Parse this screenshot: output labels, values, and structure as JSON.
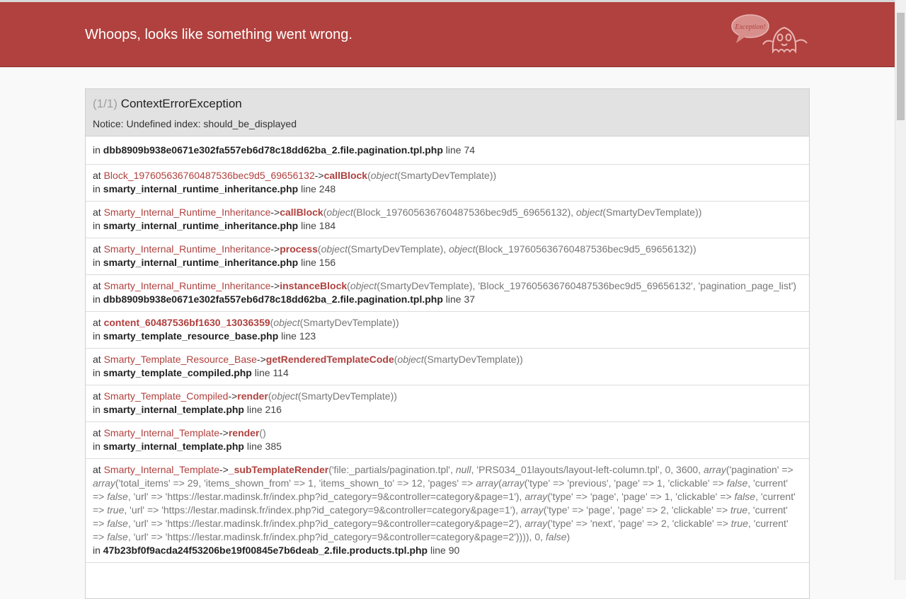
{
  "header": {
    "title": "Whoops, looks like something went wrong.",
    "logo_text": "Exception!"
  },
  "exception": {
    "count": "(1/1)",
    "class": "ContextErrorException",
    "message": "Notice: Undefined index: should_be_displayed"
  },
  "labels": {
    "in": "in",
    "at": "at",
    "line": "line",
    "arrow": "->"
  },
  "origin": {
    "file": "dbb8909b938e0671e302fa557eb6d78c18dd62ba_2.file.pagination.tpl.php",
    "line": "74"
  },
  "trace": [
    {
      "class": "Block_197605636760487536bec9d5_69656132",
      "func": "callBlock",
      "args_a": "(",
      "ph1": "object",
      "args_b": "(SmartyDevTemplate))",
      "ph2": "",
      "args_c": "",
      "file": "smarty_internal_runtime_inheritance.php",
      "line": "248"
    },
    {
      "class": "Smarty_Internal_Runtime_Inheritance",
      "func": "callBlock",
      "args_a": "(",
      "ph1": "object",
      "args_b": "(Block_197605636760487536bec9d5_69656132), ",
      "ph2": "object",
      "args_c": "(SmartyDevTemplate))",
      "file": "smarty_internal_runtime_inheritance.php",
      "line": "184"
    },
    {
      "class": "Smarty_Internal_Runtime_Inheritance",
      "func": "process",
      "args_a": "(",
      "ph1": "object",
      "args_b": "(SmartyDevTemplate), ",
      "ph2": "object",
      "args_c": "(Block_197605636760487536bec9d5_69656132))",
      "file": "smarty_internal_runtime_inheritance.php",
      "line": "156"
    },
    {
      "class": "Smarty_Internal_Runtime_Inheritance",
      "func": "instanceBlock",
      "args_a": "(",
      "ph1": "object",
      "args_b": "(SmartyDevTemplate), 'Block_197605636760487536bec9d5_69656132', 'pagination_page_list')",
      "ph2": "",
      "args_c": "",
      "file": "dbb8909b938e0671e302fa557eb6d78c18dd62ba_2.file.pagination.tpl.php",
      "line": "37"
    },
    {
      "class": "",
      "func": "content_60487536bf1630_13036359",
      "args_a": "(",
      "ph1": "object",
      "args_b": "(SmartyDevTemplate))",
      "ph2": "",
      "args_c": "",
      "file": "smarty_template_resource_base.php",
      "line": "123"
    },
    {
      "class": "Smarty_Template_Resource_Base",
      "func": "getRenderedTemplateCode",
      "args_a": "(",
      "ph1": "object",
      "args_b": "(SmartyDevTemplate))",
      "ph2": "",
      "args_c": "",
      "file": "smarty_template_compiled.php",
      "line": "114"
    },
    {
      "class": "Smarty_Template_Compiled",
      "func": "render",
      "args_a": "(",
      "ph1": "object",
      "args_b": "(SmartyDevTemplate))",
      "ph2": "",
      "args_c": "",
      "file": "smarty_internal_template.php",
      "line": "216"
    },
    {
      "class": "Smarty_Internal_Template",
      "func": "render",
      "args_a": "()",
      "ph1": "",
      "args_b": "",
      "ph2": "",
      "args_c": "",
      "file": "smarty_internal_template.php",
      "line": "385"
    }
  ],
  "last": {
    "class": "Smarty_Internal_Template",
    "func": "_subTemplateRender",
    "args": [
      {
        "t": "('file:_partials/pagination.tpl', "
      },
      {
        "i": "null"
      },
      {
        "t": ", 'PRS034_01layouts/layout-left-column.tpl', 0, 3600, "
      },
      {
        "i": "array"
      },
      {
        "t": "('pagination' => "
      },
      {
        "i": "array"
      },
      {
        "t": "('total_items' => 29, 'items_shown_from' => 1, 'items_shown_to' => 12, 'pages' => "
      },
      {
        "i": "array"
      },
      {
        "t": "("
      },
      {
        "i": "array"
      },
      {
        "t": "('type' => 'previous', 'page' => 1, 'clickable' => "
      },
      {
        "i": "false"
      },
      {
        "t": ", 'current' => "
      },
      {
        "i": "false"
      },
      {
        "t": ", 'url' => 'https://lestar.madinsk.fr/index.php?id_category=9&controller=category&page=1'), "
      },
      {
        "i": "array"
      },
      {
        "t": "('type' => 'page', 'page' => 1, 'clickable' => "
      },
      {
        "i": "false"
      },
      {
        "t": ", 'current' => "
      },
      {
        "i": "true"
      },
      {
        "t": ", 'url' => 'https://lestar.madinsk.fr/index.php?id_category=9&controller=category&page=1'), "
      },
      {
        "i": "array"
      },
      {
        "t": "('type' => 'page', 'page' => 2, 'clickable' => "
      },
      {
        "i": "true"
      },
      {
        "t": ", 'current' => "
      },
      {
        "i": "false"
      },
      {
        "t": ", 'url' => 'https://lestar.madinsk.fr/index.php?id_category=9&controller=category&page=2'), "
      },
      {
        "i": "array"
      },
      {
        "t": "('type' => 'next', 'page' => 2, 'clickable' => "
      },
      {
        "i": "true"
      },
      {
        "t": ", 'current' => "
      },
      {
        "i": "false"
      },
      {
        "t": ", 'url' => 'https://lestar.madinsk.fr/index.php?id_category=9&controller=category&page=2')))), 0, "
      },
      {
        "i": "false"
      },
      {
        "t": ")"
      }
    ],
    "file": "47b23bf0f9acda24f53206be19f00845e7b6deab_2.file.products.tpl.php",
    "line": "90"
  }
}
